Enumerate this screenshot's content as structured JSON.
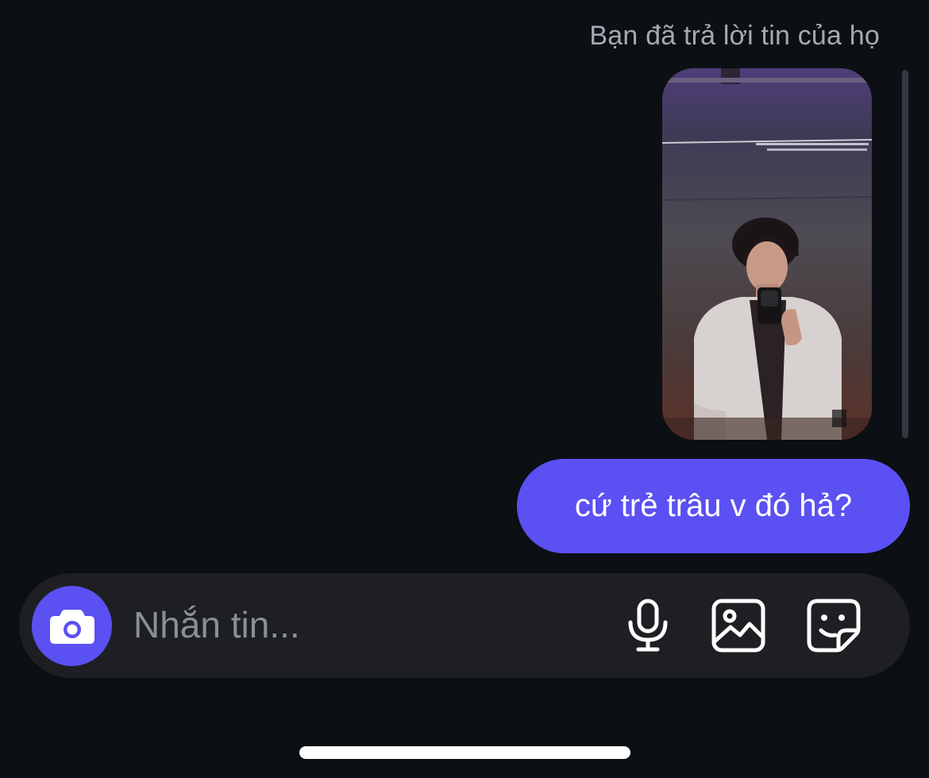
{
  "reply_note": "Bạn đã trả lời tin của họ",
  "message": {
    "text": "cứ trẻ trâu v đó hả?"
  },
  "composer": {
    "placeholder": "Nhắn tin...",
    "camera_icon": "camera-icon",
    "mic_icon": "microphone-icon",
    "gallery_icon": "image-icon",
    "sticker_icon": "sticker-icon"
  },
  "colors": {
    "background": "#0c0f14",
    "accent": "#5b50f2",
    "composer_bg": "#1d1f22",
    "muted_text": "#a5a9b1"
  }
}
